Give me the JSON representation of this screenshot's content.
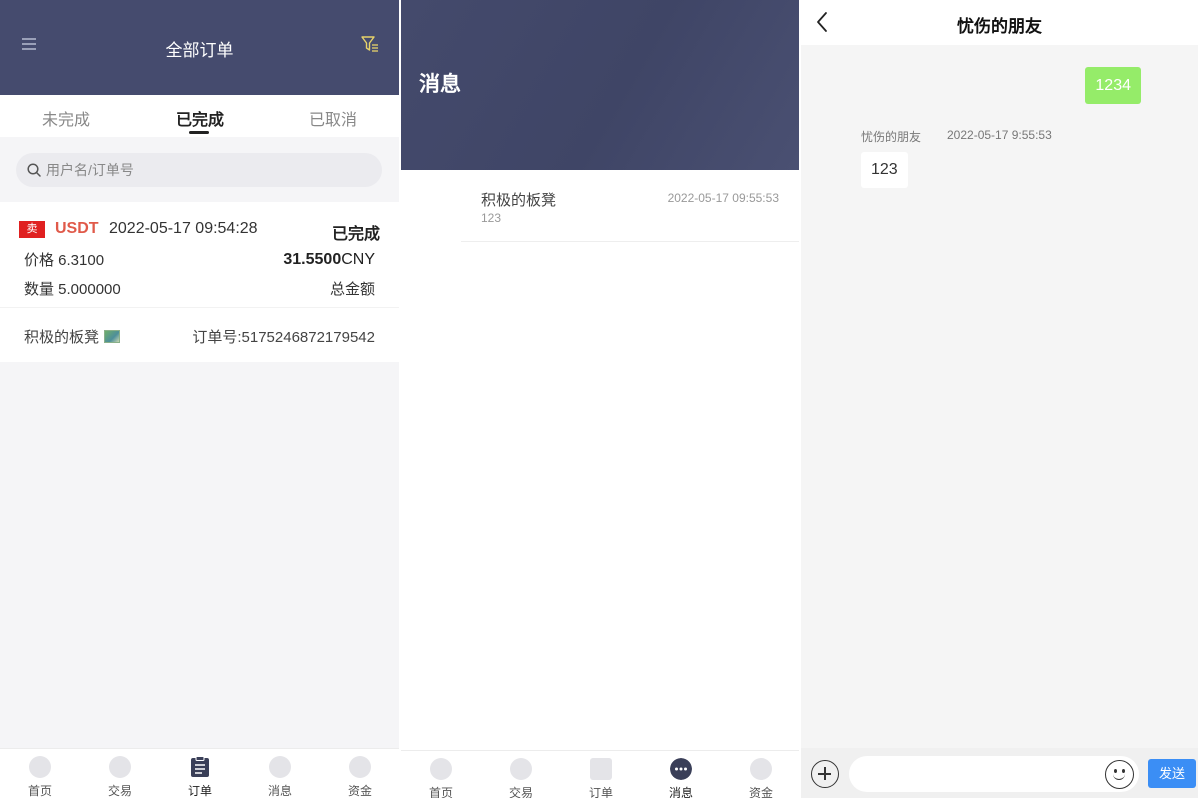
{
  "orders_panel": {
    "title": "全部订单",
    "icons": {
      "menu": "menu-icon",
      "filter": "filter-icon",
      "search": "search-icon"
    },
    "tabs": [
      {
        "label": "未完成"
      },
      {
        "label": "已完成"
      },
      {
        "label": "已取消"
      }
    ],
    "active_tab": "已完成",
    "search": {
      "placeholder": "用户名/订单号",
      "value": ""
    },
    "order": {
      "side_badge": "卖",
      "coin": "USDT",
      "time": "2022-05-17 09:54:28",
      "status": "已完成",
      "price": "价格 6.3100",
      "total_value": "31.5500",
      "total_currency": "CNY",
      "quantity": "数量 5.000000",
      "total_label": "总金额",
      "counterparty": "积极的板凳",
      "order_no": "订单号:5175246872179542"
    },
    "colors": {
      "header": "#454b6e",
      "sell": "#e02020",
      "coin": "#e05a4a"
    }
  },
  "tabbar_orders": {
    "items": [
      {
        "label": "首页",
        "icon": "home-icon"
      },
      {
        "label": "交易",
        "icon": "trade-icon"
      },
      {
        "label": "订单",
        "icon": "clipboard-icon"
      },
      {
        "label": "消息",
        "icon": "chat-icon"
      },
      {
        "label": "资金",
        "icon": "wallet-icon"
      }
    ],
    "active": "订单"
  },
  "messages_panel": {
    "title": "消息",
    "conversations": [
      {
        "name": "积极的板凳",
        "time": "2022-05-17 09:55:53",
        "preview": "123"
      }
    ]
  },
  "tabbar_messages": {
    "items": [
      {
        "label": "首页",
        "icon": "home-icon"
      },
      {
        "label": "交易",
        "icon": "trade-icon"
      },
      {
        "label": "订单",
        "icon": "list-icon"
      },
      {
        "label": "消息",
        "icon": "chat-icon"
      },
      {
        "label": "资金",
        "icon": "wallet-icon"
      }
    ],
    "active": "消息"
  },
  "chat_panel": {
    "title": "忧伤的朋友",
    "outgoing": {
      "text": "1234"
    },
    "incoming": {
      "sender": "忧伤的朋友",
      "time": "2022-05-17 9:55:53",
      "text": "123"
    },
    "input": {
      "value": "",
      "placeholder": ""
    },
    "send_label": "发送",
    "icons": {
      "back": "back-chevron-icon",
      "plus": "plus-icon",
      "emoji": "emoji-icon"
    },
    "colors": {
      "outgoing_bubble": "#95ec69",
      "send_button": "#3b8ef5"
    }
  }
}
